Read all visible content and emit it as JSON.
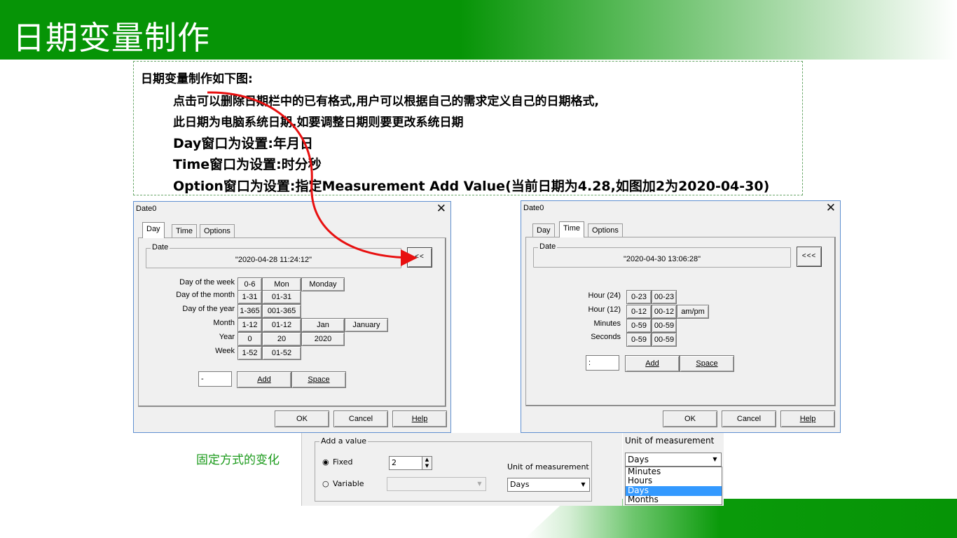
{
  "slide": {
    "title": "日期变量制作",
    "description": {
      "heading": "日期变量制作如下图:",
      "line1": "点击可以删除日期栏中的已有格式,用户可以根据自己的需求定义自己的日期格式,",
      "line2": "此日期为电脑系统日期,如要调整日期则要更改系统日期",
      "line3": "Day窗口为设置:年月日",
      "line4": "Time窗口为设置:时分秒",
      "line5": "Option窗口为设置:指定Measurement Add Value(当前日期为4.28,如图加2为2020-04-30)"
    },
    "change_label": "固定方式的变化",
    "colors": {
      "accent_green": "#069406",
      "arrow_red": "#e81010",
      "label_green": "#1a9a1a"
    }
  },
  "dialog_left": {
    "title": "Date0",
    "tabs": [
      "Day",
      "Time",
      "Options"
    ],
    "active_tab": "Day",
    "group_label": "Date",
    "date_value": "\"2020-04-28 11:24:12\"",
    "arrow_button": "<<",
    "rows": [
      {
        "label": "Day of the week",
        "cells": [
          "0-6",
          "Mon",
          "Monday"
        ]
      },
      {
        "label": "Day of the month",
        "cells": [
          "1-31",
          "01-31"
        ]
      },
      {
        "label": "Day of the year",
        "cells": [
          "1-365",
          "001-365"
        ]
      },
      {
        "label": "Month",
        "cells": [
          "1-12",
          "01-12",
          "Jan",
          "January"
        ]
      },
      {
        "label": "Year",
        "cells": [
          "0",
          "20",
          "2020"
        ]
      },
      {
        "label": "Week",
        "cells": [
          "1-52",
          "01-52"
        ]
      }
    ],
    "separator_value": "-",
    "add_label": "Add",
    "space_label": "Space",
    "ok_label": "OK",
    "cancel_label": "Cancel",
    "help_label": "Help"
  },
  "dialog_right": {
    "title": "Date0",
    "tabs": [
      "Day",
      "Time",
      "Options"
    ],
    "active_tab": "Time",
    "group_label": "Date",
    "date_value": "\"2020-04-30 13:06:28\"",
    "arrow_button": "<<<",
    "rows": [
      {
        "label": "Hour (24)",
        "cells": [
          "0-23",
          "00-23"
        ]
      },
      {
        "label": "Hour (12)",
        "cells": [
          "0-12",
          "00-12",
          "am/pm"
        ]
      },
      {
        "label": "Minutes",
        "cells": [
          "0-59",
          "00-59"
        ]
      },
      {
        "label": "Seconds",
        "cells": [
          "0-59",
          "00-59"
        ]
      }
    ],
    "separator_value": ":",
    "add_label": "Add",
    "space_label": "Space",
    "ok_label": "OK",
    "cancel_label": "Cancel",
    "help_label": "Help"
  },
  "add_value": {
    "group_label": "Add a value",
    "fixed_label": "Fixed",
    "fixed_value": "2",
    "variable_label": "Variable",
    "variable_value": "",
    "unit_label": "Unit of measurement",
    "unit_value": "Days"
  },
  "unit_dropdown": {
    "title": "Unit of measurement",
    "selected": "Days",
    "options": [
      "Minutes",
      "Hours",
      "Days",
      "Months"
    ]
  }
}
